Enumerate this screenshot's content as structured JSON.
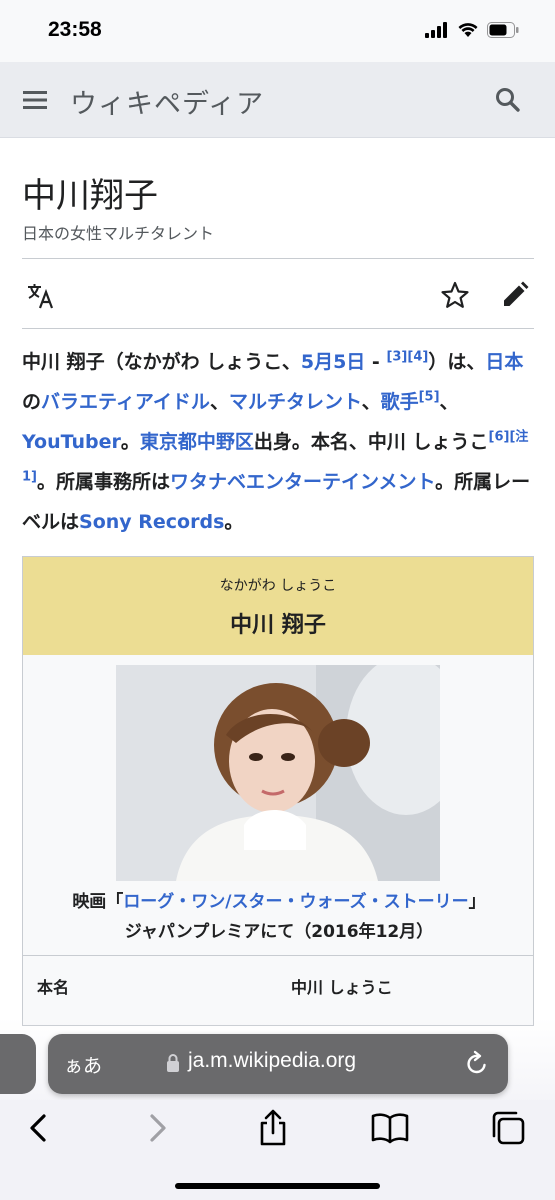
{
  "status_bar": {
    "time": "23:58"
  },
  "header": {
    "logo": "ウィキペディア"
  },
  "article": {
    "title": "中川翔子",
    "subtitle": "日本の女性マルチタレント",
    "lead": {
      "t1": "中川 翔子（なかがわ しょうこ、",
      "date_link": "5月5日",
      "t2": " - ",
      "ref3": "[3]",
      "ref4": "[4]",
      "t3": "）は、",
      "japan_link": "日本",
      "t4": "の",
      "variety_link": "バラエティアイドル",
      "t5": "、",
      "multitalent_link": "マルチタレント",
      "t6": "、",
      "singer_link": "歌手",
      "ref5": "[5]",
      "t7": "、",
      "youtuber_link": "YouTuber",
      "t8": "。",
      "nakano_link": "東京都中野区",
      "t9": "出身。本名、中川 しょうこ",
      "ref6": "[6]",
      "note1": "[注 1]",
      "t10": "。所属事務所は",
      "agency_link": "ワタナベエンターテインメント",
      "t11": "。所属レーベルは",
      "label_link": "Sony Records",
      "t12": "。"
    },
    "infobox": {
      "reading": "なかがわ しょうこ",
      "name": "中川 翔子",
      "caption_pre": "映画「",
      "caption_link": "ローグ・ワン/スター・ウォーズ・ストーリー",
      "caption_post": "」",
      "caption_line2": "ジャパンプレミアにて（2016年12月）",
      "rows": [
        {
          "label": "本名",
          "value": "中川 しょうこ"
        }
      ]
    }
  },
  "browser": {
    "aa_label": "ぁあ",
    "url": "ja.m.wikipedia.org"
  },
  "colors": {
    "link": "#3366cc",
    "infobox_header": "#ecdd93",
    "header_bg": "#eaecf0"
  }
}
